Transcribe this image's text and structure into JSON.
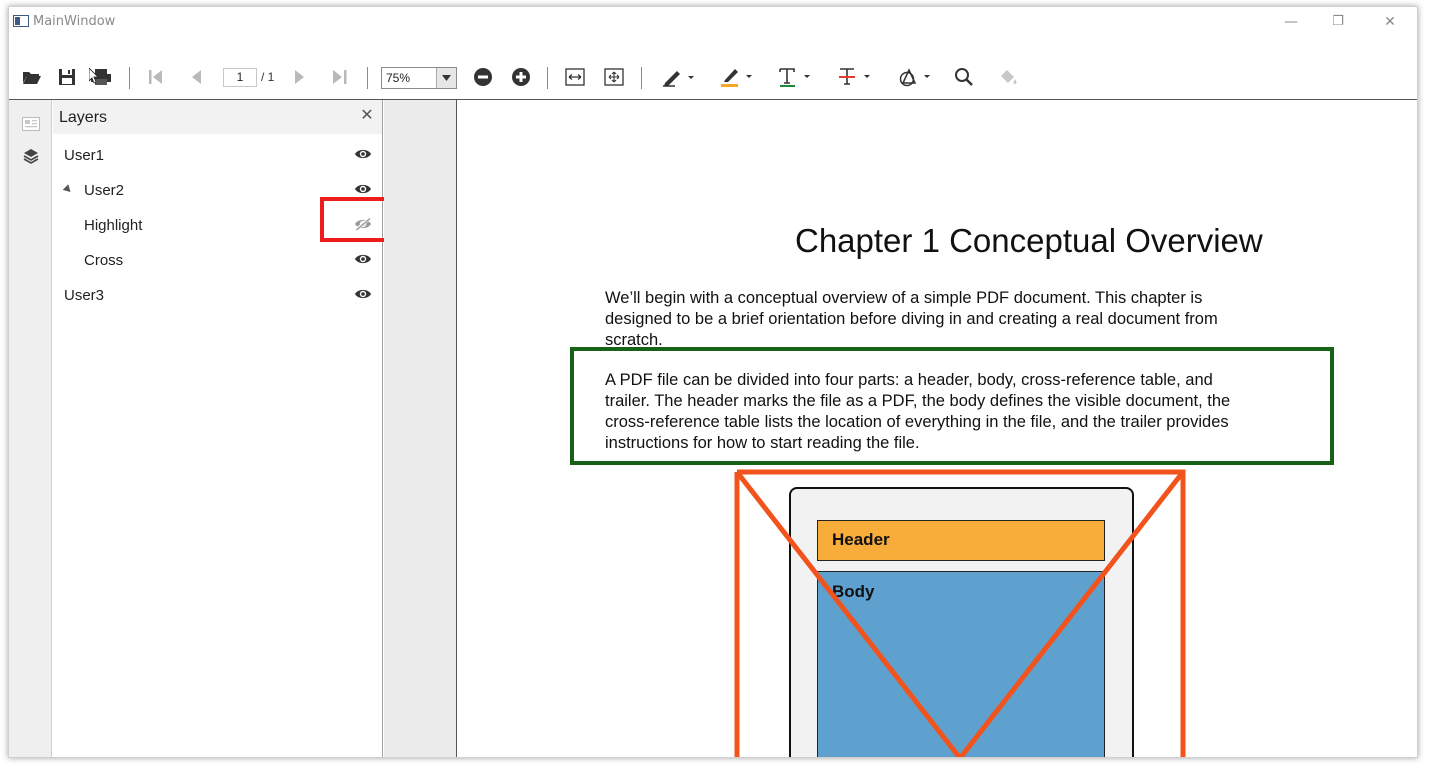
{
  "window": {
    "title": "MainWindow",
    "controls": {
      "minimize": "—",
      "restore": "❐",
      "close": "✕"
    }
  },
  "toolbar": {
    "page_current": "1",
    "page_total": "/ 1",
    "zoom_value": "75%",
    "icons": [
      "open-icon",
      "save-icon",
      "print-icon",
      "first-page-icon",
      "prev-page-icon",
      "next-page-icon",
      "last-page-icon",
      "zoom-out-icon",
      "zoom-in-icon",
      "fit-width-icon",
      "fit-page-icon",
      "pen-icon",
      "highlighter-icon",
      "text-icon",
      "strikethrough-icon",
      "shape-icon",
      "search-icon",
      "fill-icon"
    ]
  },
  "layers": {
    "title": "Layers",
    "close": "✕",
    "items": [
      {
        "label": "User1",
        "visible": true,
        "indent": 0
      },
      {
        "label": "User2",
        "visible": true,
        "indent": 0,
        "expanded": true
      },
      {
        "label": "Highlight",
        "visible": false,
        "indent": 1
      },
      {
        "label": "Cross",
        "visible": true,
        "indent": 1
      },
      {
        "label": "User3",
        "visible": true,
        "indent": 0
      }
    ]
  },
  "document": {
    "heading": "Chapter 1  Conceptual Overview",
    "para1": [
      "We’ll begin with a conceptual overview of a simple PDF document. This chapter is",
      "designed to be a brief orientation before diving in and creating a real document from",
      "scratch."
    ],
    "para2": [
      "A PDF file can be divided into four parts: a header, body, cross-reference table, and",
      "trailer. The header marks the file as a PDF, the body defines the visible document, the",
      "cross-reference table lists the location of everything in the file, and the trailer provides",
      "instructions for how to start reading the file."
    ],
    "diagram": {
      "header_label": "Header",
      "body_label": "Body"
    }
  },
  "colors": {
    "highlight_red": "#ee1c1c",
    "green_annotation": "#186218",
    "cross_orange": "#f2531c",
    "header_orange": "#f8ac3a",
    "body_blue": "#5ea1cf"
  }
}
